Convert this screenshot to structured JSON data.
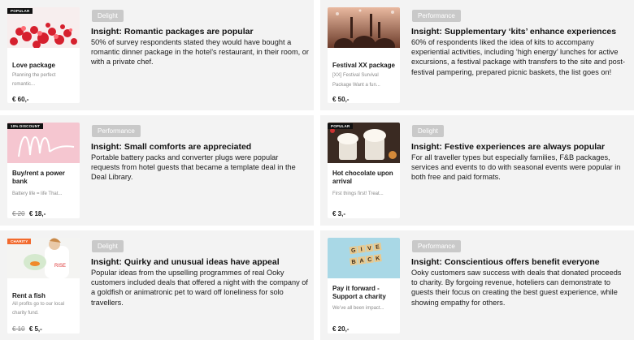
{
  "cells": [
    {
      "card": {
        "tag": "POPULAR",
        "title": "Love package",
        "desc": "Planning the perfect romantic...",
        "price_old": "",
        "price": "€ 60,-"
      },
      "badge": "Delight",
      "insight_title": "Insight: Romantic packages are popular",
      "insight_body": "50% of survey respondents stated they would have bought a romantic dinner package in the hotel’s restaurant, in their room, or with a private chef."
    },
    {
      "card": {
        "tag": "",
        "title": "Festival XX package",
        "desc": "[XX] Festival Survival Package Want a fun...",
        "price_old": "",
        "price": "€ 50,-"
      },
      "badge": "Performance",
      "insight_title": "Insight: Supplementary ‘kits’ enhance experiences",
      "insight_body": "60% of respondents liked the idea of kits to accompany experiential activities, including ‘high energy’ lunches for active excursions, a festival package with transfers to the site and post-festival pampering, prepared picnic baskets, the list goes on!"
    },
    {
      "card": {
        "tag": "10% DISCOUNT",
        "title": "Buy/rent a power bank",
        "desc": "Battery life = life That...",
        "price_old": "€ 20",
        "price": "€ 18,-"
      },
      "badge": "Performance",
      "insight_title": "Insight: Small comforts are appreciated",
      "insight_body": "Portable battery packs and converter plugs were popular requests from hotel guests that became a template deal in the Deal Library."
    },
    {
      "card": {
        "tag": "POPULAR",
        "title": "Hot chocolate upon arrival",
        "desc": "First things first! Treat...",
        "price_old": "",
        "price": "€ 3,-"
      },
      "badge": "Delight",
      "insight_title": "Insight: Festive experiences are always popular",
      "insight_body": "For all traveller types but especially families, F&B packages, services and events to do with seasonal events were popular in both free and paid formats."
    },
    {
      "card": {
        "tag": "CHARITY",
        "title": "Rent a fish",
        "desc": "All profits go to our local charity fund.",
        "price_old": "€ 10",
        "price": "€ 5,-"
      },
      "badge": "Delight",
      "insight_title": "Insight: Quirky and unusual ideas have appeal",
      "insight_body": "Popular ideas from the upselling programmes of real Ooky customers included deals that offered a night with the company of a goldfish or animatronic pet to ward off loneliness for solo travellers."
    },
    {
      "card": {
        "tag": "",
        "title": "Pay it forward - Support a charity",
        "desc": "We’ve all been impact...",
        "price_old": "",
        "price": "€ 20,-"
      },
      "badge": "Performance",
      "insight_title": "Insight: Conscientious offers benefit everyone",
      "insight_body": "Ooky customers saw success with deals that donated proceeds to charity. By forgoing revenue, hoteliers can demonstrate to guests their focus on creating the best guest experience, while showing empathy for others."
    }
  ],
  "tiles": {
    "scrabble_letters": [
      "G",
      "I",
      "V",
      "E",
      "B",
      "A",
      "C",
      "K"
    ]
  }
}
